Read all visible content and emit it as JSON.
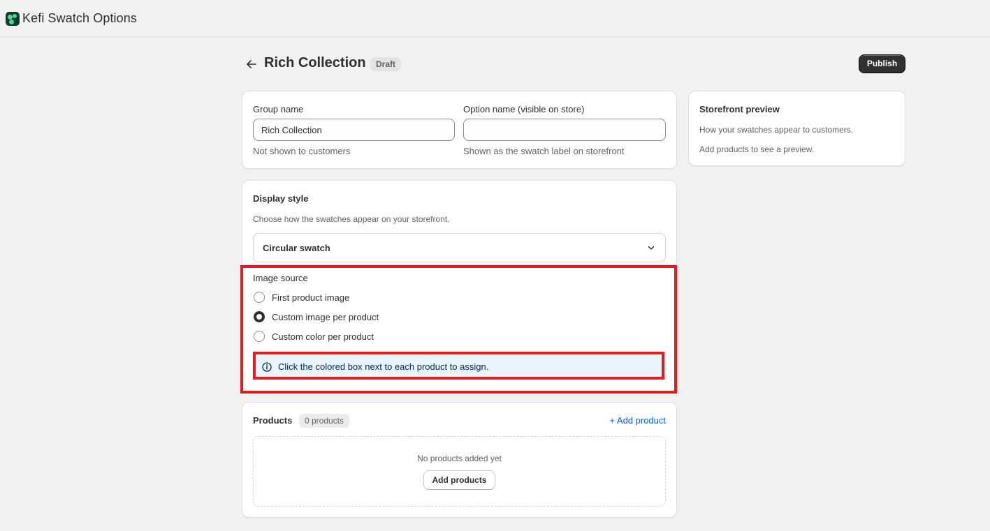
{
  "app": {
    "title": "Kefi Swatch Options",
    "logo_icon": "app-logo-icon"
  },
  "page": {
    "title": "Rich Collection",
    "status": "Draft",
    "back_icon": "arrow-left-icon",
    "publish_label": "Publish"
  },
  "group_card": {
    "group_name_label": "Group name",
    "group_name_value": "Rich Collection",
    "group_name_help": "Not shown to customers",
    "option_name_label": "Option name (visible on store)",
    "option_name_value": "",
    "option_name_help": "Shown as the swatch label on storefront"
  },
  "preview_card": {
    "title": "Storefront preview",
    "description": "How your swatches appear to customers.",
    "empty_text": "Add products to see a preview."
  },
  "display_card": {
    "title": "Display style",
    "description": "Choose how the swatches appear on your storefront.",
    "select_value": "Circular swatch",
    "image_source_label": "Image source",
    "options": [
      {
        "label": "First product image",
        "selected": false
      },
      {
        "label": "Custom image per product",
        "selected": true
      },
      {
        "label": "Custom color per product",
        "selected": false
      }
    ],
    "info_text": "Click the colored box next to each product to assign."
  },
  "products_card": {
    "title": "Products",
    "count": "0 products",
    "add_link": "+ Add product",
    "empty_text": "No products added yet",
    "add_button": "Add products"
  },
  "colors": {
    "highlight": "#e11d24",
    "primary_button": "#303030",
    "link": "#005bd3",
    "info_bg": "#eaf4ff"
  }
}
